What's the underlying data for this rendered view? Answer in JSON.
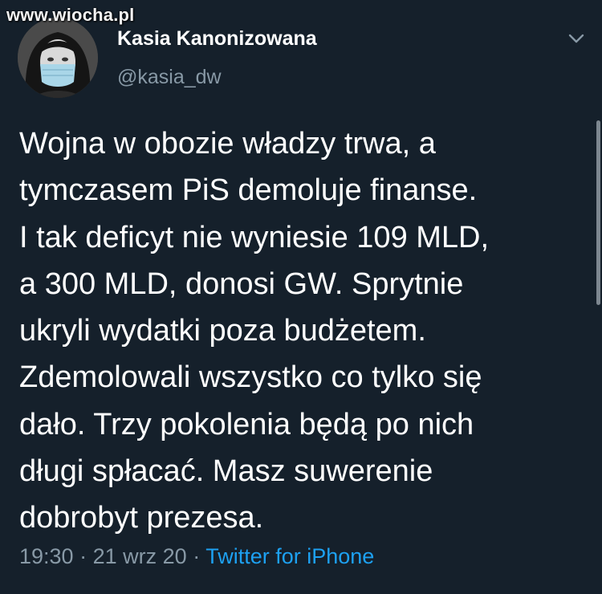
{
  "watermark": "www.wiocha.pl",
  "user": {
    "display_name": "Kasia Kanonizowana",
    "handle": "@kasia_dw"
  },
  "tweet": {
    "text": "Wojna w obozie władzy trwa, a\ntymczasem PiS demoluje finanse.\nI tak deficyt nie wyniesie 109 MLD,\na 300 MLD, donosi GW. Sprytnie\nukryli wydatki poza budżetem.\nZdemolowali wszystko co tylko się\ndało. Trzy pokolenia będą po nich\ndługi spłacać. Masz suwerenie\ndobrobyt prezesa.",
    "time": "19:30",
    "date": "21 wrz 20",
    "separator": "·",
    "source": "Twitter for iPhone"
  },
  "icons": {
    "more": "chevron-down-icon"
  },
  "colors": {
    "background": "#15202b",
    "text": "#ffffff",
    "secondary_text": "#8899a6",
    "link": "#1da1f2"
  }
}
